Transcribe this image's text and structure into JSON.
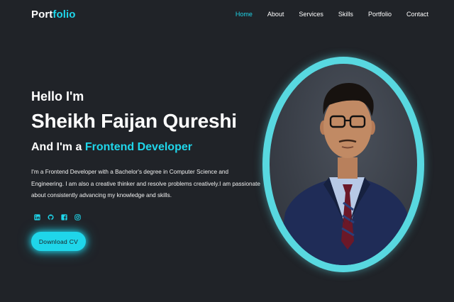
{
  "nav": {
    "logo_part1": "Port",
    "logo_part2": "folio",
    "links": [
      {
        "label": "Home",
        "active": true
      },
      {
        "label": "About",
        "active": false
      },
      {
        "label": "Services",
        "active": false
      },
      {
        "label": "Skills",
        "active": false
      },
      {
        "label": "Portfolio",
        "active": false
      },
      {
        "label": "Contact",
        "active": false
      }
    ]
  },
  "hero": {
    "greeting": "Hello I'm",
    "name": "Sheikh Faijan Qureshi",
    "role_prefix": "And I'm a",
    "role_highlight": "Frontend Developer",
    "bio": "I'm a Frontend Developer with a Bachelor's degree in Computer Science and Engineering. I am also a creative thinker and resolve problems creatively.I am passionate about consistently advancing my knowledge and skills.",
    "socials": [
      "linkedin-icon",
      "github-icon",
      "facebook-icon",
      "instagram-icon"
    ],
    "cv_button": "Download CV"
  },
  "colors": {
    "accent": "#1fd6ea",
    "background": "#202328",
    "ring": "#58d8e0"
  }
}
